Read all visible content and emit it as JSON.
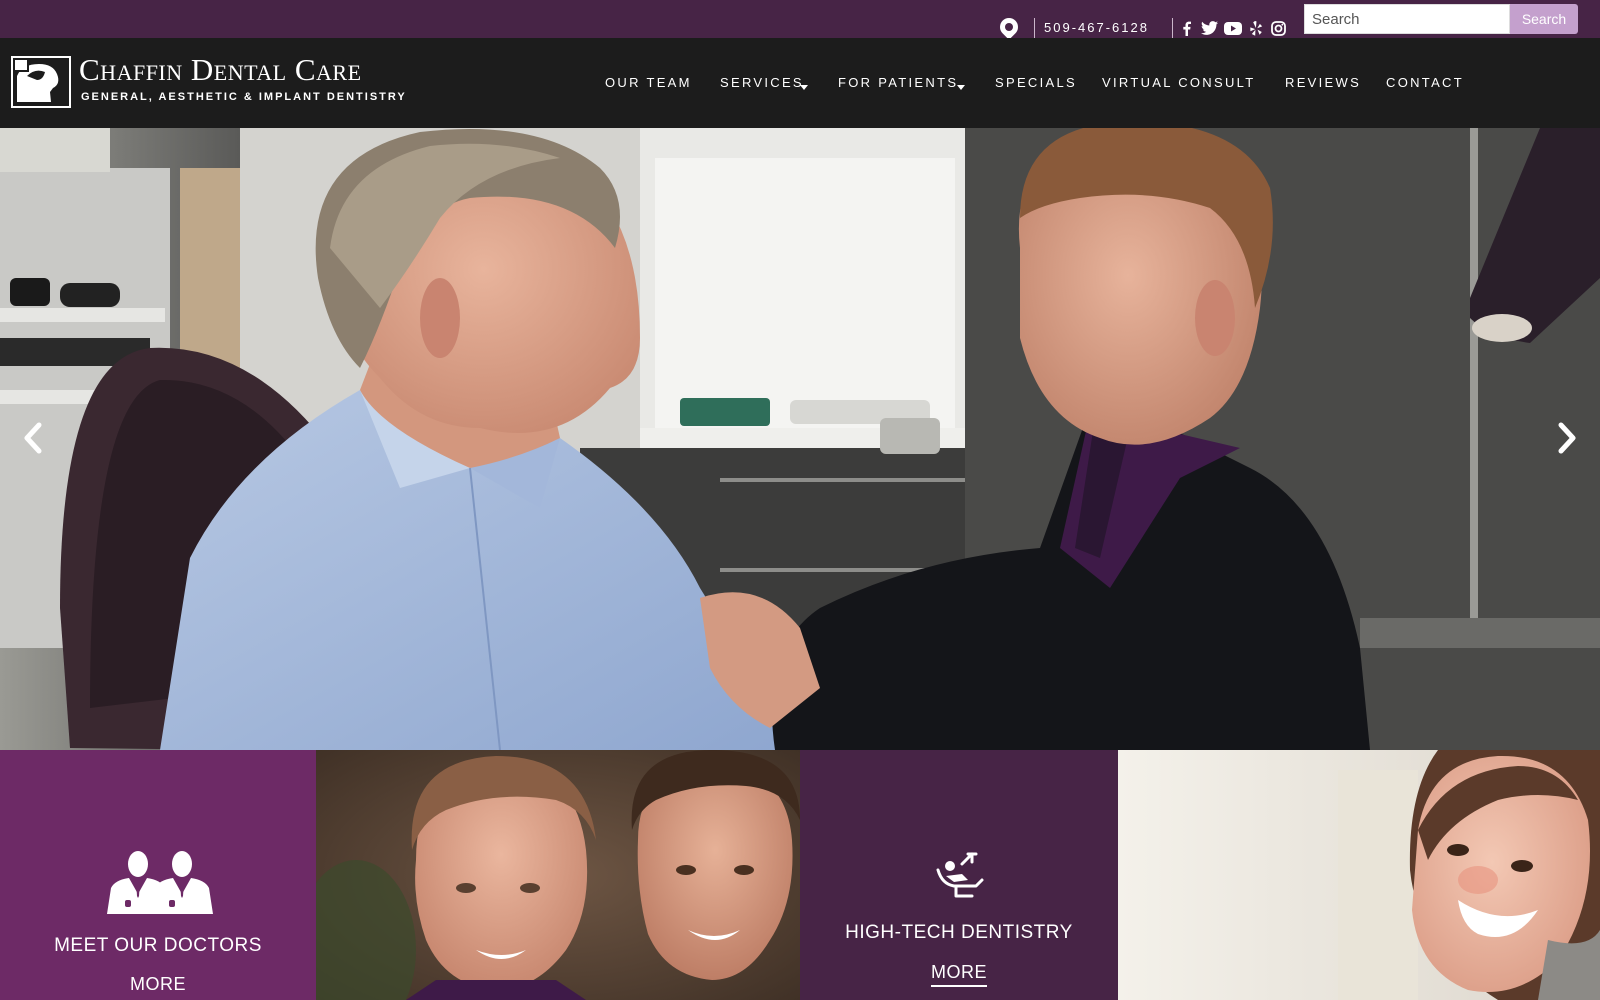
{
  "topbar": {
    "phone": "509-467-6128",
    "search_placeholder": "Search",
    "search_button": "Search",
    "social": [
      "facebook-icon",
      "twitter-icon",
      "youtube-icon",
      "yelp-icon",
      "instagram-icon"
    ]
  },
  "brand": {
    "name": "Chaffin Dental Care",
    "tagline": "GENERAL, AESTHETIC & IMPLANT DENTISTRY"
  },
  "nav": {
    "items": [
      {
        "label": "OUR TEAM",
        "dropdown": false
      },
      {
        "label": "SERVICES",
        "dropdown": true
      },
      {
        "label": "FOR PATIENTS",
        "dropdown": true
      },
      {
        "label": "SPECIALS",
        "dropdown": false
      },
      {
        "label": "VIRTUAL CONSULT",
        "dropdown": false
      },
      {
        "label": "REVIEWS",
        "dropdown": false
      },
      {
        "label": "CONTACT",
        "dropdown": false
      }
    ]
  },
  "hero": {
    "prev_icon": "chevron-left-icon",
    "next_icon": "chevron-right-icon"
  },
  "tiles": [
    {
      "title": "MEET OUR DOCTORS",
      "more": "MORE",
      "icon": "doctors-icon"
    },
    {
      "title": "HIGH-TECH DENTISTRY",
      "more": "MORE",
      "icon": "dental-chair-icon"
    }
  ],
  "colors": {
    "topbar": "#472446",
    "header": "#1c1c1c",
    "tile_doctors": "#6d2a66",
    "tile_tech": "#472446",
    "search_button": "#c4a0cd"
  }
}
